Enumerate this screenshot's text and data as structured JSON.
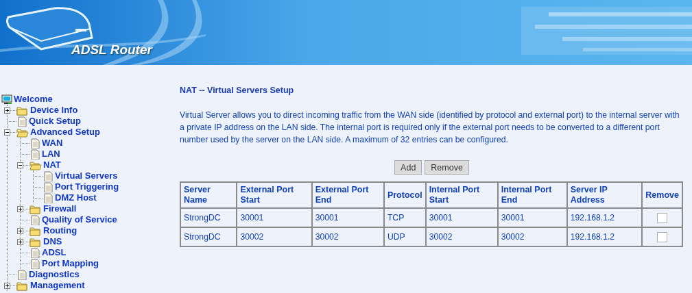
{
  "header": {
    "title": "ADSL Router"
  },
  "tree": {
    "label": "Welcome",
    "kind": "root",
    "children": [
      {
        "label": "Device Info",
        "kind": "folder",
        "expanded": false
      },
      {
        "label": "Quick Setup",
        "kind": "page"
      },
      {
        "label": "Advanced Setup",
        "kind": "folder",
        "expanded": true,
        "children": [
          {
            "label": "WAN",
            "kind": "page"
          },
          {
            "label": "LAN",
            "kind": "page"
          },
          {
            "label": "NAT",
            "kind": "folder",
            "expanded": true,
            "children": [
              {
                "label": "Virtual Servers",
                "kind": "page"
              },
              {
                "label": "Port Triggering",
                "kind": "page"
              },
              {
                "label": "DMZ Host",
                "kind": "page"
              }
            ]
          },
          {
            "label": "Firewall",
            "kind": "folder",
            "expanded": false
          },
          {
            "label": "Quality of Service",
            "kind": "page"
          },
          {
            "label": "Routing",
            "kind": "folder",
            "expanded": false
          },
          {
            "label": "DNS",
            "kind": "folder",
            "expanded": false
          },
          {
            "label": "ADSL",
            "kind": "page"
          },
          {
            "label": "Port Mapping",
            "kind": "page"
          }
        ]
      },
      {
        "label": "Diagnostics",
        "kind": "page"
      },
      {
        "label": "Management",
        "kind": "folder",
        "expanded": false
      }
    ]
  },
  "content": {
    "title": "NAT -- Virtual Servers Setup",
    "description": "Virtual Server allows you to direct incoming traffic from the WAN side (identified by protocol and external port) to the internal server with a private IP address on the LAN side. The internal port is required only if the external port needs to be converted to a different port number used by the server on the LAN side. A maximum of 32 entries can be configured.",
    "buttons": [
      "Add",
      "Remove"
    ],
    "table": {
      "columns": [
        "Server Name",
        "External Port Start",
        "External Port End",
        "Protocol",
        "Internal Port Start",
        "Internal Port End",
        "Server IP Address",
        "Remove"
      ],
      "rows": [
        {
          "cells": [
            "StrongDC",
            "30001",
            "30001",
            "TCP",
            "30001",
            "30001",
            "192.168.1.2"
          ],
          "remove_checked": false
        },
        {
          "cells": [
            "StrongDC",
            "30002",
            "30002",
            "UDP",
            "30002",
            "30002",
            "192.168.1.2"
          ],
          "remove_checked": false
        }
      ]
    }
  }
}
